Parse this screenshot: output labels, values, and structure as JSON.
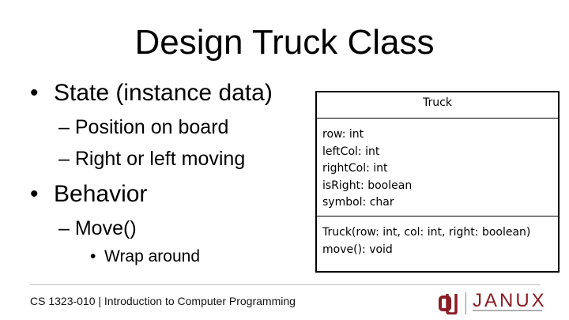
{
  "slide": {
    "title": "Design Truck Class",
    "bullets": [
      {
        "level": 1,
        "bullet": "•",
        "text": "State (instance data)"
      },
      {
        "level": 2,
        "bullet": "–",
        "text": "Position on board"
      },
      {
        "level": 2,
        "bullet": "–",
        "text": "Right or left moving"
      },
      {
        "level": 1,
        "bullet": "•",
        "text": "Behavior"
      },
      {
        "level": 2,
        "bullet": "–",
        "text": "Move()"
      },
      {
        "level": 3,
        "bullet": "•",
        "text": "Wrap around"
      }
    ]
  },
  "uml": {
    "class_name": "Truck",
    "attributes": [
      "row: int",
      "leftCol: int",
      "rightCol: int",
      "isRight: boolean",
      "symbol: char"
    ],
    "operations": [
      "Truck(row: int, col: int, right: boolean)",
      "move(): void"
    ]
  },
  "footer": {
    "course": "CS 1323-010 | Introduction to Computer Programming",
    "logo_text": "JANUX",
    "logo_icon": "ou-logo-icon",
    "brand_color": "#8a1d24"
  }
}
